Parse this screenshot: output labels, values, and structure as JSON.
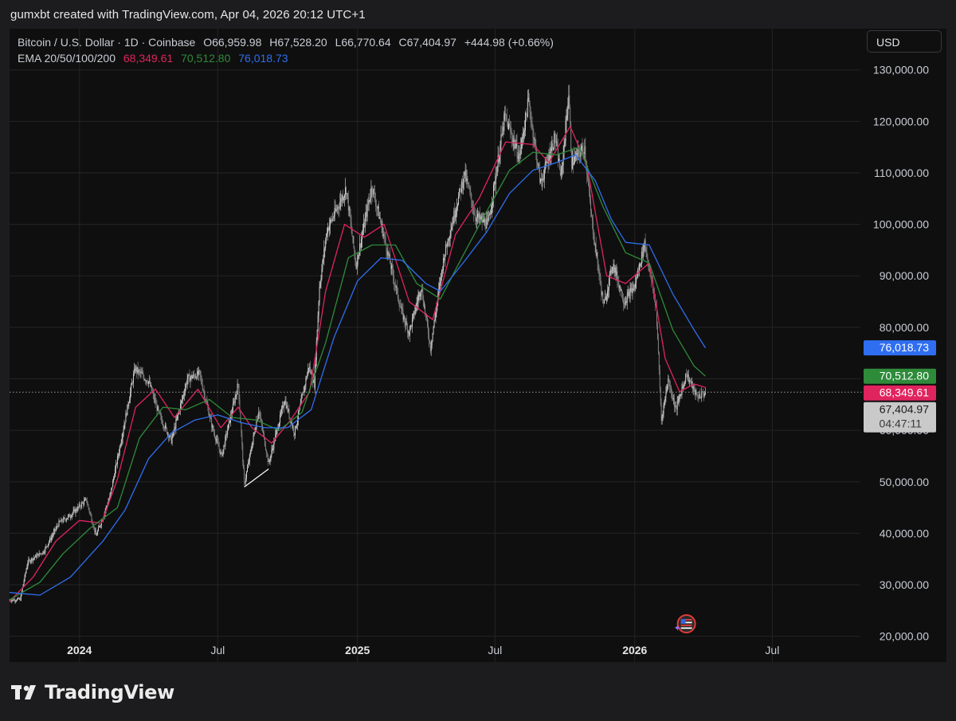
{
  "header": {
    "text": "gumxbt created with TradingView.com, Apr 04, 2026 20:12 UTC+1"
  },
  "legend": {
    "symbol": "Bitcoin / U.S. Dollar · 1D · Coinbase",
    "open": "O66,959.98",
    "high": "H67,528.20",
    "low": "L66,770.64",
    "close": "C67,404.97",
    "change": "+444.98 (+0.66%)",
    "ema_label": "EMA 20/50/100/200",
    "ema20": "68,349.61",
    "ema50": "70,512.80",
    "ema100": "76,018.73"
  },
  "currency_button": "USD",
  "colors": {
    "background": "#0f0f0f",
    "outer": "#1c1c1e",
    "ema20": "#e0245e",
    "ema50": "#2e8b3a",
    "ema100": "#2f6ef0",
    "price_label": "#c9c9c9",
    "up_candle": "#d8d8d8",
    "down_candle": "#8a8a8a"
  },
  "brand": {
    "name": "TradingView",
    "icon": "tradingview-logo-icon"
  },
  "event_marker": {
    "icon": "us-flag-event-icon"
  },
  "chart_data": {
    "type": "candlestick",
    "timeframe": "1D",
    "symbol": "Bitcoin / U.S. Dollar",
    "exchange": "Coinbase",
    "y_axis": {
      "ticks": [
        20000,
        30000,
        40000,
        50000,
        60000,
        70000,
        80000,
        90000,
        100000,
        110000,
        120000,
        130000
      ],
      "tick_labels": [
        "20,000.00",
        "30,000.00",
        "40,000.00",
        "50,000.00",
        "60,000.00",
        "",
        "80,000.00",
        "90,000.00",
        "100,000.00",
        "110,000.00",
        "120,000.00",
        "130,000.00"
      ],
      "range": [
        15000,
        138000
      ]
    },
    "x_axis": {
      "range": [
        "2023-10-01",
        "2026-10-25"
      ],
      "ticks": [
        {
          "date": "2024-01-01",
          "label": "2024",
          "bold": true
        },
        {
          "date": "2024-07-01",
          "label": "Jul",
          "bold": false
        },
        {
          "date": "2025-01-01",
          "label": "2025",
          "bold": true
        },
        {
          "date": "2025-07-01",
          "label": "Jul",
          "bold": false
        },
        {
          "date": "2026-01-01",
          "label": "2026",
          "bold": true
        },
        {
          "date": "2026-07-01",
          "label": "Jul",
          "bold": false
        }
      ]
    },
    "grid": true,
    "price_line": {
      "value": 67404.97,
      "style": "dotted"
    },
    "labels": [
      {
        "name": "EMA 100",
        "value": 76018.73,
        "text": "76,018.73",
        "color": "#2f6ef0"
      },
      {
        "name": "EMA 50",
        "value": 70512.8,
        "text": "70,512.80",
        "color": "#2e8b3a"
      },
      {
        "name": "EMA 20",
        "value": 68349.61,
        "text": "68,349.61",
        "color": "#e0245e"
      },
      {
        "name": "Last",
        "value": 67404.97,
        "text": "67,404.97",
        "countdown": "04:47:11",
        "color": "#c9c9c9"
      }
    ],
    "price_path": [
      [
        "2023-10-01",
        27000
      ],
      [
        "2023-10-15",
        27200
      ],
      [
        "2023-10-25",
        34500
      ],
      [
        "2023-11-15",
        36500
      ],
      [
        "2023-12-05",
        42000
      ],
      [
        "2023-12-20",
        43500
      ],
      [
        "2024-01-10",
        46500
      ],
      [
        "2024-01-23",
        39500
      ],
      [
        "2024-02-10",
        47000
      ],
      [
        "2024-02-28",
        60500
      ],
      [
        "2024-03-14",
        72000
      ],
      [
        "2024-04-01",
        69500
      ],
      [
        "2024-04-15",
        63000
      ],
      [
        "2024-05-01",
        58000
      ],
      [
        "2024-05-22",
        70000
      ],
      [
        "2024-06-07",
        71000
      ],
      [
        "2024-06-24",
        60500
      ],
      [
        "2024-07-06",
        55000
      ],
      [
        "2024-07-28",
        69000
      ],
      [
        "2024-08-05",
        49500
      ],
      [
        "2024-08-24",
        64000
      ],
      [
        "2024-09-06",
        53500
      ],
      [
        "2024-09-27",
        66000
      ],
      [
        "2024-10-10",
        59500
      ],
      [
        "2024-10-29",
        72500
      ],
      [
        "2024-11-05",
        69000
      ],
      [
        "2024-11-12",
        88000
      ],
      [
        "2024-11-22",
        99000
      ],
      [
        "2024-12-05",
        103000
      ],
      [
        "2024-12-17",
        107000
      ],
      [
        "2024-12-30",
        92000
      ],
      [
        "2025-01-20",
        107500
      ],
      [
        "2025-02-05",
        97500
      ],
      [
        "2025-02-28",
        83000
      ],
      [
        "2025-03-10",
        79000
      ],
      [
        "2025-03-26",
        88000
      ],
      [
        "2025-04-07",
        76000
      ],
      [
        "2025-04-25",
        94000
      ],
      [
        "2025-05-22",
        110000
      ],
      [
        "2025-06-05",
        101500
      ],
      [
        "2025-06-22",
        100000
      ],
      [
        "2025-07-14",
        121000
      ],
      [
        "2025-08-02",
        113000
      ],
      [
        "2025-08-14",
        124000
      ],
      [
        "2025-08-30",
        108000
      ],
      [
        "2025-09-18",
        117000
      ],
      [
        "2025-09-26",
        109000
      ],
      [
        "2025-10-06",
        125500
      ],
      [
        "2025-10-10",
        112000
      ],
      [
        "2025-10-27",
        115000
      ],
      [
        "2025-11-05",
        101000
      ],
      [
        "2025-11-21",
        84000
      ],
      [
        "2025-12-03",
        92500
      ],
      [
        "2025-12-18",
        85000
      ],
      [
        "2026-01-01",
        88000
      ],
      [
        "2026-01-14",
        96500
      ],
      [
        "2026-01-29",
        84000
      ],
      [
        "2026-02-05",
        62000
      ],
      [
        "2026-02-14",
        70000
      ],
      [
        "2026-02-24",
        64000
      ],
      [
        "2026-03-10",
        71000
      ],
      [
        "2026-03-24",
        66500
      ],
      [
        "2026-04-04",
        67405
      ]
    ],
    "series": [
      {
        "name": "EMA 20",
        "color": "#e0245e",
        "points": [
          [
            "2023-10-01",
            26800
          ],
          [
            "2023-11-01",
            31500
          ],
          [
            "2023-12-01",
            38500
          ],
          [
            "2024-01-01",
            42500
          ],
          [
            "2024-01-30",
            42000
          ],
          [
            "2024-02-20",
            50500
          ],
          [
            "2024-03-15",
            64500
          ],
          [
            "2024-04-10",
            68000
          ],
          [
            "2024-05-05",
            62500
          ],
          [
            "2024-06-05",
            68000
          ],
          [
            "2024-07-05",
            60500
          ],
          [
            "2024-07-28",
            64500
          ],
          [
            "2024-08-15",
            60500
          ],
          [
            "2024-09-10",
            57500
          ],
          [
            "2024-10-05",
            62000
          ],
          [
            "2024-10-30",
            67500
          ],
          [
            "2024-11-20",
            87000
          ],
          [
            "2024-12-15",
            100000
          ],
          [
            "2025-01-10",
            97500
          ],
          [
            "2025-02-05",
            100000
          ],
          [
            "2025-03-10",
            85000
          ],
          [
            "2025-04-10",
            81500
          ],
          [
            "2025-05-10",
            98000
          ],
          [
            "2025-06-10",
            105000
          ],
          [
            "2025-07-15",
            116000
          ],
          [
            "2025-08-20",
            115500
          ],
          [
            "2025-09-10",
            112000
          ],
          [
            "2025-10-08",
            119000
          ],
          [
            "2025-10-30",
            111500
          ],
          [
            "2025-11-25",
            90000
          ],
          [
            "2025-12-20",
            88500
          ],
          [
            "2026-01-20",
            92500
          ],
          [
            "2026-02-10",
            74000
          ],
          [
            "2026-03-01",
            67500
          ],
          [
            "2026-03-20",
            69000
          ],
          [
            "2026-04-04",
            68349.61
          ]
        ]
      },
      {
        "name": "EMA 50",
        "color": "#2e8b3a",
        "points": [
          [
            "2023-10-01",
            27100
          ],
          [
            "2023-11-10",
            30500
          ],
          [
            "2023-12-10",
            36000
          ],
          [
            "2024-01-15",
            41000
          ],
          [
            "2024-02-20",
            45000
          ],
          [
            "2024-03-20",
            58500
          ],
          [
            "2024-04-20",
            64500
          ],
          [
            "2024-05-20",
            64000
          ],
          [
            "2024-06-20",
            66000
          ],
          [
            "2024-07-20",
            62500
          ],
          [
            "2024-08-20",
            62000
          ],
          [
            "2024-09-20",
            60000
          ],
          [
            "2024-10-20",
            63500
          ],
          [
            "2024-11-20",
            77000
          ],
          [
            "2024-12-20",
            93500
          ],
          [
            "2025-01-20",
            96000
          ],
          [
            "2025-02-20",
            96000
          ],
          [
            "2025-03-20",
            88500
          ],
          [
            "2025-04-20",
            85500
          ],
          [
            "2025-05-20",
            94000
          ],
          [
            "2025-06-20",
            102500
          ],
          [
            "2025-07-20",
            110500
          ],
          [
            "2025-08-20",
            114000
          ],
          [
            "2025-09-20",
            113500
          ],
          [
            "2025-10-20",
            115000
          ],
          [
            "2025-11-20",
            103500
          ],
          [
            "2025-12-20",
            94500
          ],
          [
            "2026-01-20",
            92500
          ],
          [
            "2026-02-20",
            79500
          ],
          [
            "2026-03-20",
            72500
          ],
          [
            "2026-04-04",
            70512.8
          ]
        ]
      },
      {
        "name": "EMA 100",
        "color": "#2f6ef0",
        "points": [
          [
            "2023-10-01",
            28500
          ],
          [
            "2023-11-10",
            28000
          ],
          [
            "2023-12-20",
            31500
          ],
          [
            "2024-02-01",
            38500
          ],
          [
            "2024-03-01",
            44500
          ],
          [
            "2024-04-01",
            54500
          ],
          [
            "2024-05-01",
            59500
          ],
          [
            "2024-06-01",
            62000
          ],
          [
            "2024-07-01",
            63000
          ],
          [
            "2024-08-01",
            61500
          ],
          [
            "2024-09-01",
            60500
          ],
          [
            "2024-10-01",
            60500
          ],
          [
            "2024-11-01",
            64000
          ],
          [
            "2024-12-01",
            78000
          ],
          [
            "2025-01-01",
            89000
          ],
          [
            "2025-02-01",
            93500
          ],
          [
            "2025-03-01",
            93000
          ],
          [
            "2025-04-01",
            88500
          ],
          [
            "2025-04-20",
            87000
          ],
          [
            "2025-05-20",
            92500
          ],
          [
            "2025-06-20",
            98500
          ],
          [
            "2025-07-20",
            106000
          ],
          [
            "2025-08-20",
            110500
          ],
          [
            "2025-09-20",
            112000
          ],
          [
            "2025-10-15",
            113500
          ],
          [
            "2025-11-10",
            108500
          ],
          [
            "2025-12-01",
            101000
          ],
          [
            "2025-12-20",
            96500
          ],
          [
            "2026-01-20",
            96000
          ],
          [
            "2026-02-20",
            86500
          ],
          [
            "2026-03-20",
            79500
          ],
          [
            "2026-04-04",
            76018.73
          ]
        ]
      }
    ],
    "annotation_line": [
      [
        "2024-08-05",
        49000
      ],
      [
        "2024-09-06",
        52500
      ]
    ]
  }
}
